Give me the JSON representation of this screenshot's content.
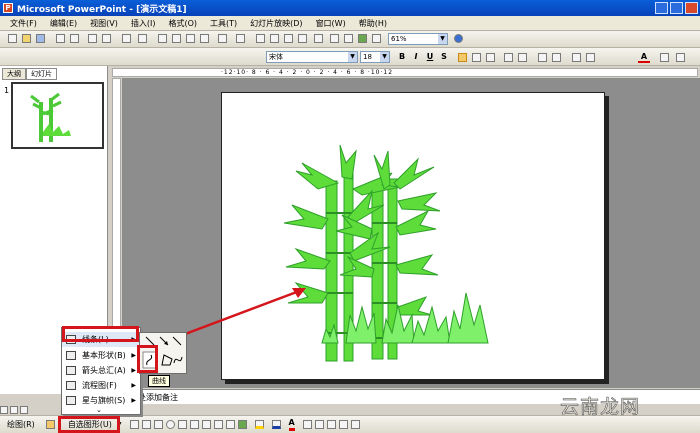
{
  "app": {
    "title": "Microsoft PowerPoint - [演示文稿1]",
    "logo_letter": "P"
  },
  "menu": [
    "文件(F)",
    "编辑(E)",
    "视图(V)",
    "插入(I)",
    "格式(O)",
    "工具(T)",
    "幻灯片放映(D)",
    "窗口(W)",
    "帮助(H)"
  ],
  "toolbar": {
    "zoom": "61%",
    "font_name": "宋体",
    "font_size": "18",
    "bold": "B",
    "italic": "I",
    "underline": "U",
    "shadow": "S",
    "font_color_letter": "A"
  },
  "left_pane": {
    "tabs": [
      "大纲",
      "幻灯片"
    ],
    "slide_number": "1"
  },
  "ruler": {
    "marks": "·12·10· 8 · 6 · 4 · 2 · 0 · 2 · 4 · 6 · 8 ·10·12"
  },
  "notes": {
    "placeholder": "单击此处添加备注",
    "visible_text": "处添加备注"
  },
  "drawing_toolbar": {
    "draw_label": "绘图(R)",
    "autoshapes_label": "自选图形(U)"
  },
  "autoshapes_menu": {
    "items": [
      {
        "label": "线条(L)",
        "icon": "lines-icon"
      },
      {
        "label": "基本形状(B)",
        "icon": "basic-shapes-icon"
      },
      {
        "label": "箭头总汇(A)",
        "icon": "block-arrows-icon"
      },
      {
        "label": "流程图(F)",
        "icon": "flowchart-icon"
      },
      {
        "label": "星与旗帜(S)",
        "icon": "stars-banners-icon"
      }
    ]
  },
  "lines_submenu": {
    "tooltip": "曲线",
    "tools": [
      "line-icon",
      "arrow-icon",
      "double-arrow-icon",
      "curve-icon",
      "freeform-icon",
      "scribble-icon"
    ]
  },
  "annotation": {
    "color": "#d4151b"
  },
  "watermark": "云南龙网",
  "colors": {
    "bamboo_light": "#5ddc3a",
    "bamboo_dark": "#2fa02a",
    "workspace": "#8d8d8d",
    "titlebar": "#0a5fd8"
  }
}
